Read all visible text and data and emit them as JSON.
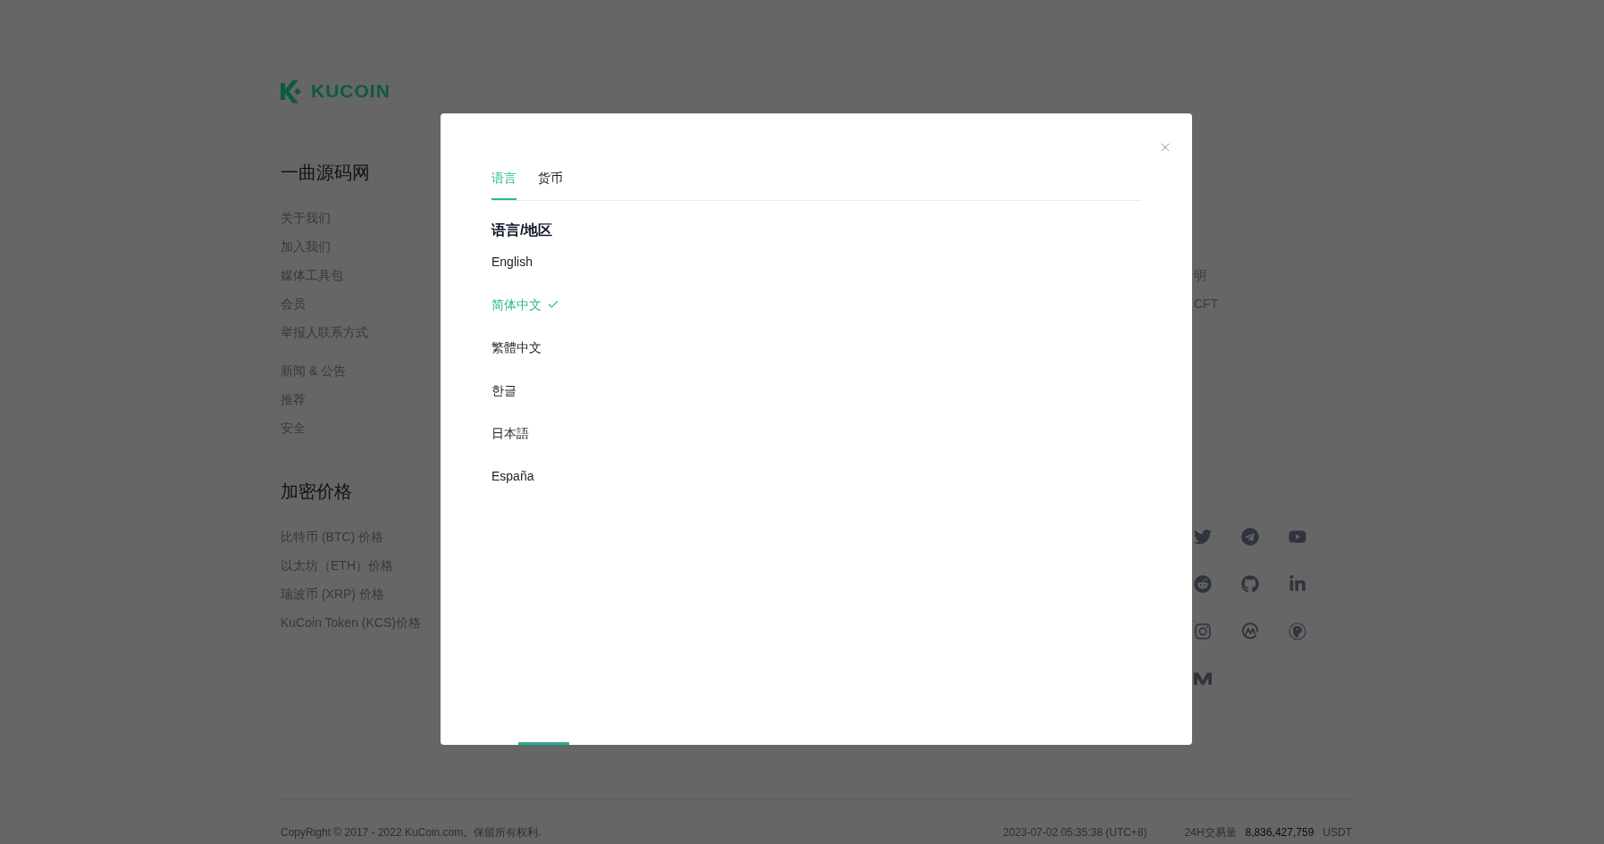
{
  "logo": {
    "wordmark": "KUCOIN"
  },
  "footer_columns": [
    {
      "title": "一曲源码网",
      "groups": [
        {
          "links": [
            "关于我们",
            "加入我们",
            "媒体工具包",
            "会员",
            "举报人联系方式"
          ]
        },
        {
          "links": [
            "新闻 & 公告",
            "推荐",
            "安全"
          ]
        }
      ]
    },
    {
      "title": "加密价格",
      "groups": [
        {
          "links": [
            "比特币 (BTC) 价格",
            "以太坊（ETH）价格",
            "瑞波币 (XRP) 价格",
            "KuCoin Token (KCS)价格"
          ]
        }
      ]
    }
  ],
  "partial_column": {
    "links": [
      "明",
      "CFT"
    ]
  },
  "bottom_bar": {
    "copyright": "CopyRight © 2017 - 2022 KuCoin.com。保留所有权利.",
    "timestamp": "2023-07-02 05:35:38 (UTC+8)",
    "volume_label": "24H交易量",
    "volume_value": "8,836,427,759",
    "volume_unit": "USDT"
  },
  "modal": {
    "tabs": [
      {
        "label": "语言",
        "selected": true
      },
      {
        "label": "货币",
        "selected": false
      }
    ],
    "section_title": "语言/地区",
    "languages": [
      {
        "label": "English",
        "selected": false
      },
      {
        "label": "简体中文",
        "selected": true
      },
      {
        "label": "繁體中文",
        "selected": false
      },
      {
        "label": "한글",
        "selected": false
      },
      {
        "label": "日本語",
        "selected": false
      },
      {
        "label": "España",
        "selected": false
      }
    ]
  }
}
